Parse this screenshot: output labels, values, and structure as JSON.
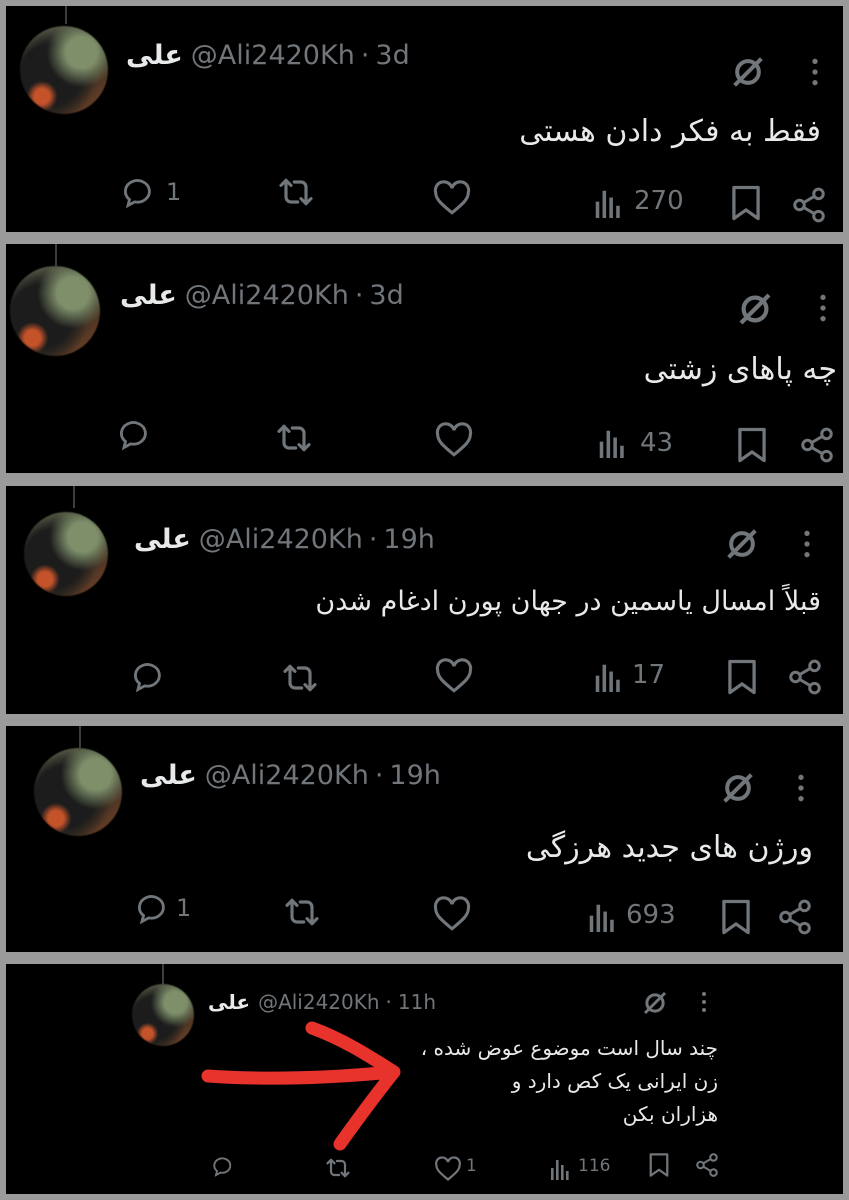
{
  "tweets": [
    {
      "name": "علی",
      "handle": "@Ali2420Kh",
      "dot": "·",
      "time": "3d",
      "text": "فقط به فکر دادن هستی",
      "replies": "1",
      "views": "270"
    },
    {
      "name": "علی",
      "handle": "@Ali2420Kh",
      "dot": "·",
      "time": "3d",
      "text": "چه پاهای زشتی",
      "replies": "",
      "views": "43"
    },
    {
      "name": "علی",
      "handle": "@Ali2420Kh",
      "dot": "·",
      "time": "19h",
      "text": "قبلاً امسال یاسمین در جهان پورن ادغام شدن",
      "replies": "",
      "views": "17"
    },
    {
      "name": "علی",
      "handle": "@Ali2420Kh",
      "dot": "·",
      "time": "19h",
      "text": "ورژن های جدید هرزگی",
      "replies": "1",
      "views": "693"
    },
    {
      "name": "علی",
      "handle": "@Ali2420Kh",
      "dot": "·",
      "time": "11h",
      "text": "چند سال است موضوع عوض شده ،\nزن ایرانی یک کص دارد و\nهزاران بکن",
      "replies": "",
      "likes": "1",
      "views": "116"
    }
  ],
  "colors": {
    "background": "#000000",
    "text": "#e7e9ea",
    "muted": "#71767b",
    "annotation_arrow": "#e8322c"
  },
  "icons": [
    "reply-icon",
    "retweet-icon",
    "like-icon",
    "views-icon",
    "bookmark-icon",
    "share-icon",
    "grok-icon",
    "more-icon"
  ]
}
